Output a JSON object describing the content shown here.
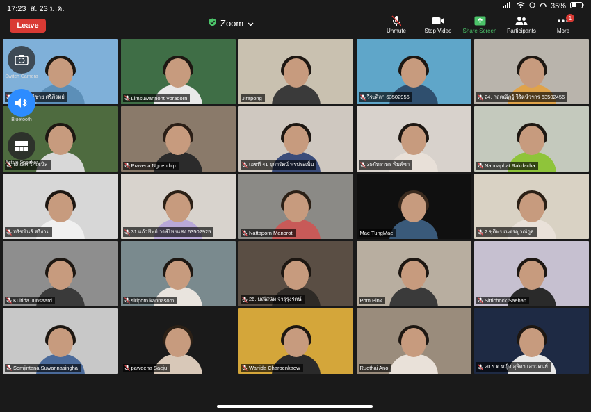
{
  "status_bar": {
    "time": "17:23",
    "date": "ส. 23 ม.ค.",
    "battery": "35%"
  },
  "meeting": {
    "title": "Zoom",
    "leave_label": "Leave"
  },
  "toolbar": [
    {
      "label": "Unmute",
      "icon": "mic-muted-icon"
    },
    {
      "label": "Stop Video",
      "icon": "video-camera-icon"
    },
    {
      "label": "Share Screen",
      "icon": "share-screen-icon"
    },
    {
      "label": "Participants",
      "icon": "participants-icon"
    },
    {
      "label": "More",
      "icon": "more-icon",
      "badge": "1"
    }
  ],
  "side_controls": [
    {
      "label": "Switch Camera",
      "icon": "switch-camera-icon"
    },
    {
      "label": "Bluetooth",
      "icon": "bluetooth-speaker-icon"
    },
    {
      "label": "Active Speaker",
      "icon": "active-speaker-icon"
    }
  ],
  "colors": {
    "leave": "#d93a34",
    "share": "#4cc46a",
    "active_border": "#7ed957"
  },
  "participants": [
    {
      "name": "4 42 ชาติชาย ศรีภิรมย์",
      "bg": "#7fb0d9",
      "shirt": "#5c8fb8",
      "hair": "#1d1712",
      "muted": true
    },
    {
      "name": "Limsuwannont Voradorn",
      "bg": "#3f6e46",
      "shirt": "#e9e9e9",
      "hair": "#1d1712",
      "muted": true
    },
    {
      "name": "Jirapong",
      "bg": "#c9c1b0",
      "shirt": "#3a3a3a",
      "hair": "#1d1712",
      "muted": false,
      "active": true
    },
    {
      "name": "วีระศิลา 63502956",
      "bg": "#5fa6c9",
      "shirt": "#2f4f6e",
      "hair": "#1d1712",
      "muted": true
    },
    {
      "name": "24. กฤตณัฏฐ์ วิรัตน์วรกร 63502456",
      "bg": "#b9b4ac",
      "shirt": "#e0a34a",
      "hair": "#1d1712",
      "muted": true
    },
    {
      "name": "นักเลิศ โกเชนิส",
      "bg": "#4e6b3f",
      "shirt": "#d8d8d8",
      "hair": "#1d1712",
      "muted": true
    },
    {
      "name": "Pravena Ngoenthip",
      "bg": "#8a7a6a",
      "shirt": "#2b2b2b",
      "hair": "#2a1e16",
      "muted": true
    },
    {
      "name": "เอชที 41 ยุภารัตน์ พรประเพ็บ",
      "bg": "#cfc8c0",
      "shirt": "#3a4c7a",
      "hair": "#1d1712",
      "muted": true
    },
    {
      "name": "35ภัทราพร พิมพ์ชา",
      "bg": "#d8d2cc",
      "shirt": "#e8e0d8",
      "hair": "#1d1712",
      "muted": true
    },
    {
      "name": "Nannaphat Rakdacha",
      "bg": "#c4c9bd",
      "shirt": "#8fc43a",
      "hair": "#1d1712",
      "muted": true
    },
    {
      "name": "ทรัชพันธ์ ศรีงาม",
      "bg": "#d7d7d7",
      "shirt": "#f0f0f0",
      "hair": "#1d1712",
      "muted": true
    },
    {
      "name": "31.แก้วทิพย์ วงษ์ไทยแสง 63502925",
      "bg": "#d8d3cd",
      "shirt": "#b9a8d9",
      "hair": "#2b2016",
      "muted": true
    },
    {
      "name": "Nattaporn Manorot",
      "bg": "#8b8a86",
      "shirt": "#c85a58",
      "hair": "#2b2016",
      "muted": true
    },
    {
      "name": "Mae TungMae",
      "bg": "#101010",
      "shirt": "#3a5a7a",
      "hair": "#3a2a1e",
      "muted": false
    },
    {
      "name": "2 ชุติพร เนตรญาณ์กูล",
      "bg": "#d9d2c4",
      "shirt": "#e9e1d9",
      "hair": "#2b2016",
      "muted": true
    },
    {
      "name": "Kultida Junsaard",
      "bg": "#8e8e8e",
      "shirt": "#3a3a3a",
      "hair": "#1d1712",
      "muted": true
    },
    {
      "name": "siriporn kannasorn",
      "bg": "#7a8a8e",
      "shirt": "#e9e4de",
      "hair": "#1d1712",
      "muted": true
    },
    {
      "name": "26. มณีสนัท จารุรุ่งรัตน์",
      "bg": "#5a4e44",
      "shirt": "#2e2a26",
      "hair": "#1d1712",
      "muted": true
    },
    {
      "name": "Pom Pink",
      "bg": "#b8aea0",
      "shirt": "#3a3a3a",
      "hair": "#1d1712",
      "muted": false
    },
    {
      "name": "Sittichock Saehan",
      "bg": "#c6c0d0",
      "shirt": "#2a2a2a",
      "hair": "#1d1712",
      "muted": true
    },
    {
      "name": "Somjintana Suwannasingha",
      "bg": "#c8c8c8",
      "shirt": "#4a6a9a",
      "hair": "#1d1712",
      "muted": true
    },
    {
      "name": "paweena Saeju",
      "bg": "#1a1a1a",
      "shirt": "#d8c8b8",
      "hair": "#2b2016",
      "muted": true
    },
    {
      "name": "Wanida Charoenkaew",
      "bg": "#d4a63a",
      "shirt": "#2a2a2a",
      "hair": "#1d1712",
      "muted": true
    },
    {
      "name": "Ruethai Ano",
      "bg": "#9a8c7c",
      "shirt": "#e9e1d9",
      "hair": "#1d1712",
      "muted": false
    },
    {
      "name": "20 ร.ต.หญิง สุธิดา เสาวดนย์",
      "bg": "#1e2a44",
      "shirt": "#e8e8e8",
      "hair": "#1d1712",
      "muted": true
    }
  ]
}
